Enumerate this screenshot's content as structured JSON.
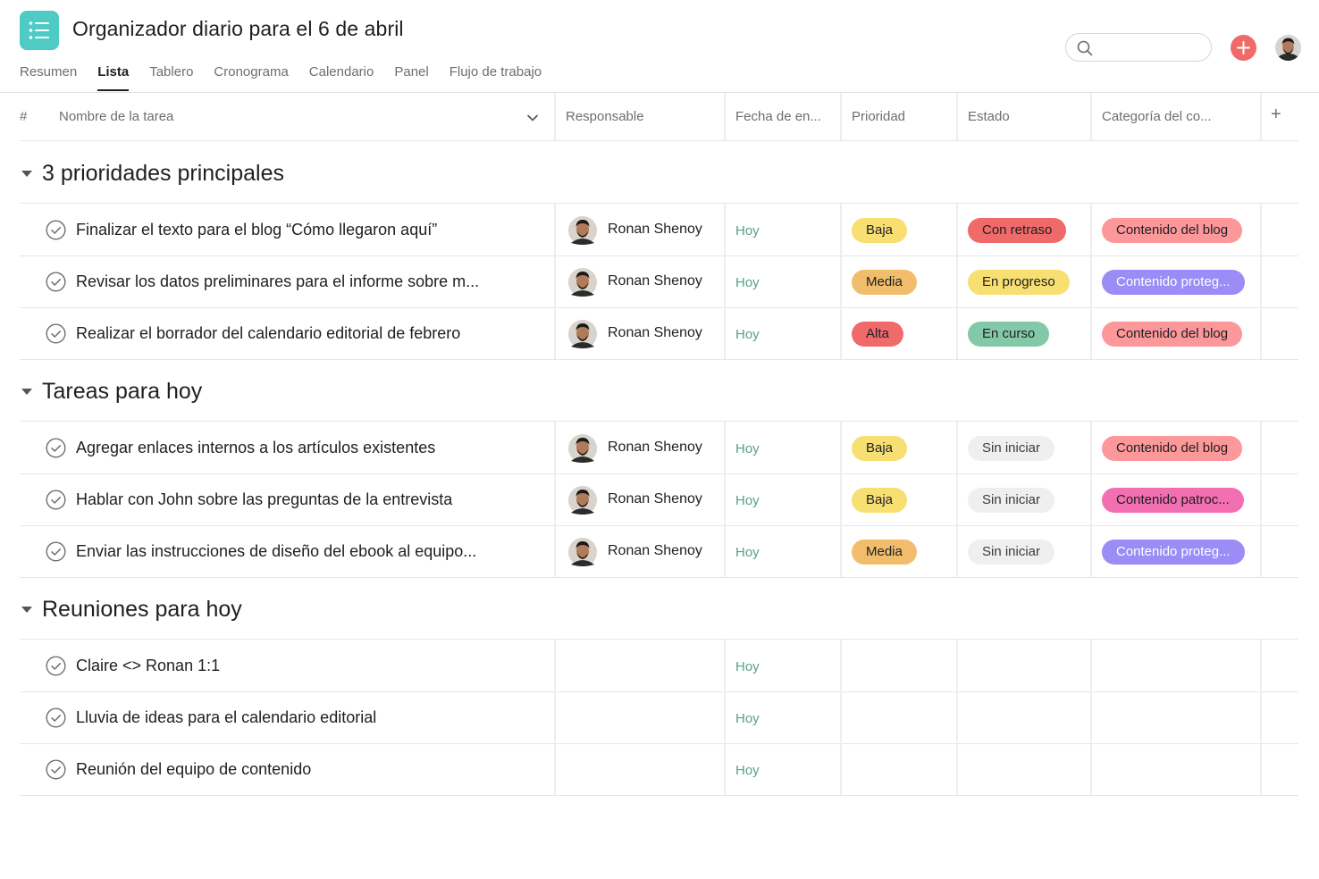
{
  "colors": {
    "app_icon": "#4ecbc4",
    "add_button": "#f06a6a",
    "due_today": "#58a182",
    "priority_baja": "#f8df72",
    "priority_media": "#f1bd6c",
    "priority_alta": "#f06a6a",
    "status_con_retraso": "#f06a6a",
    "status_en_progreso": "#f8df72",
    "status_en_curso": "#83c9a9",
    "status_sin_iniciar": "#efefef",
    "category_blog": "#fc979a",
    "category_protegido": "#9b8cf6",
    "category_patrocinado": "#f26fb2"
  },
  "header": {
    "app_icon": "list-icon",
    "title": "Organizador diario para el 6 de abril",
    "tabs": [
      {
        "label": "Resumen",
        "active": false
      },
      {
        "label": "Lista",
        "active": true
      },
      {
        "label": "Tablero",
        "active": false
      },
      {
        "label": "Cronograma",
        "active": false
      },
      {
        "label": "Calendario",
        "active": false
      },
      {
        "label": "Panel",
        "active": false
      },
      {
        "label": "Flujo de trabajo",
        "active": false
      }
    ],
    "search_placeholder": "",
    "search_icon": "search-icon",
    "add_icon": "plus-icon",
    "avatar_icon": "user-avatar"
  },
  "columns": {
    "number": "#",
    "task": "Nombre de la tarea",
    "assignee": "Responsable",
    "due": "Fecha de en...",
    "priority": "Prioridad",
    "status": "Estado",
    "category": "Categoría del co...",
    "add": "+"
  },
  "sections": [
    {
      "title": "3 prioridades principales",
      "tasks": [
        {
          "name": "Finalizar el texto para el blog “Cómo llegaron aquí”",
          "assignee": "Ronan Shenoy",
          "due": "Hoy",
          "priority": "Baja",
          "status": "Con retraso",
          "category": "Contenido del blog"
        },
        {
          "name": "Revisar los datos preliminares para el informe sobre m...",
          "assignee": "Ronan Shenoy",
          "due": "Hoy",
          "priority": "Media",
          "status": "En progreso",
          "category": "Contenido proteg..."
        },
        {
          "name": "Realizar el borrador del calendario editorial de febrero",
          "assignee": "Ronan Shenoy",
          "due": "Hoy",
          "priority": "Alta",
          "status": "En curso",
          "category": "Contenido del blog"
        }
      ]
    },
    {
      "title": "Tareas para hoy",
      "tasks": [
        {
          "name": "Agregar enlaces internos a los artículos existentes",
          "assignee": "Ronan Shenoy",
          "due": "Hoy",
          "priority": "Baja",
          "status": "Sin iniciar",
          "category": "Contenido del blog"
        },
        {
          "name": "Hablar con John sobre las preguntas de la entrevista",
          "assignee": "Ronan Shenoy",
          "due": "Hoy",
          "priority": "Baja",
          "status": "Sin iniciar",
          "category": "Contenido patroc..."
        },
        {
          "name": "Enviar las instrucciones de diseño del ebook al equipo...",
          "assignee": "Ronan Shenoy",
          "due": "Hoy",
          "priority": "Media",
          "status": "Sin iniciar",
          "category": "Contenido proteg..."
        }
      ]
    },
    {
      "title": "Reuniones para hoy",
      "tasks": [
        {
          "name": "Claire <> Ronan 1:1",
          "assignee": "",
          "due": "Hoy",
          "priority": "",
          "status": "",
          "category": ""
        },
        {
          "name": "Lluvia de ideas para el calendario editorial",
          "assignee": "",
          "due": "Hoy",
          "priority": "",
          "status": "",
          "category": ""
        },
        {
          "name": "Reunión del equipo de contenido",
          "assignee": "",
          "due": "Hoy",
          "priority": "",
          "status": "",
          "category": ""
        }
      ]
    }
  ]
}
